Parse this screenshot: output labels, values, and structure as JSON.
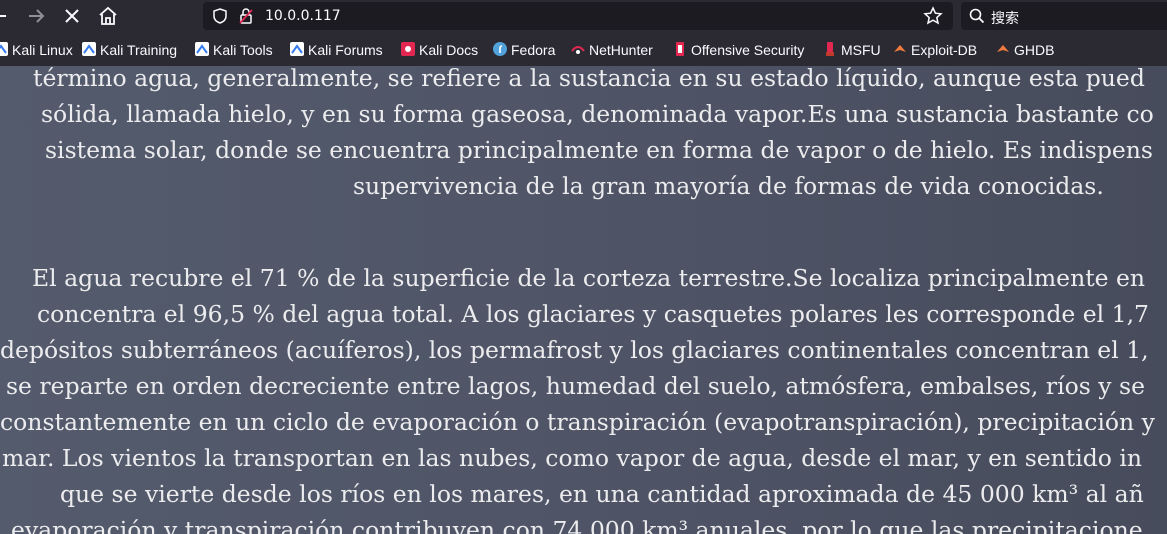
{
  "toolbar": {
    "url": "10.0.0.117",
    "search_placeholder": "搜索"
  },
  "bookmarks": [
    {
      "label": "Kali Linux",
      "icon": "kali-icon"
    },
    {
      "label": "Kali Training",
      "icon": "kali-icon"
    },
    {
      "label": "Kali Tools",
      "icon": "kali-icon"
    },
    {
      "label": "Kali Forums",
      "icon": "kali-icon"
    },
    {
      "label": "Kali Docs",
      "icon": "kali-docs-icon"
    },
    {
      "label": "Fedora",
      "icon": "fedora-icon"
    },
    {
      "label": "NetHunter",
      "icon": "nethunter-icon"
    },
    {
      "label": "Offensive Security",
      "icon": "offsec-icon"
    },
    {
      "label": "MSFU",
      "icon": "msfu-icon"
    },
    {
      "label": "Exploit-DB",
      "icon": "exploitdb-icon"
    },
    {
      "label": "GHDB",
      "icon": "ghdb-icon"
    }
  ],
  "page": {
    "lines": [
      "término agua, generalmente, se refiere a la sustancia en su estado líquido, aunque esta pued",
      "sólida, llamada hielo, y en su forma gaseosa, denominada vapor.Es una sustancia bastante co",
      "sistema solar, donde se encuentra principalmente en forma de vapor o de hielo. Es indispens",
      "supervivencia de la gran mayoría de formas de vida conocidas.",
      "El agua recubre el 71 % de la superficie de la corteza terrestre.Se localiza principalmente en",
      "concentra el 96,5 % del agua total. A los glaciares y casquetes polares les corresponde el 1,7",
      "depósitos subterráneos (acuíferos), los permafrost y los glaciares continentales concentran el 1,",
      "se reparte en orden decreciente entre lagos, humedad del suelo, atmósfera, embalses, ríos y se",
      "constantemente en un ciclo de evaporación o transpiración (evapotranspiración), precipitación y",
      "mar. Los vientos la transportan en las nubes, como vapor de agua, desde el mar, y en sentido in",
      "que se vierte desde los ríos en los mares, en una cantidad aproximada de 45 000 km³ al añ",
      "evaporación y transpiración contribuyen con 74 000 km³ anuales, por lo que las precipitacione"
    ]
  }
}
